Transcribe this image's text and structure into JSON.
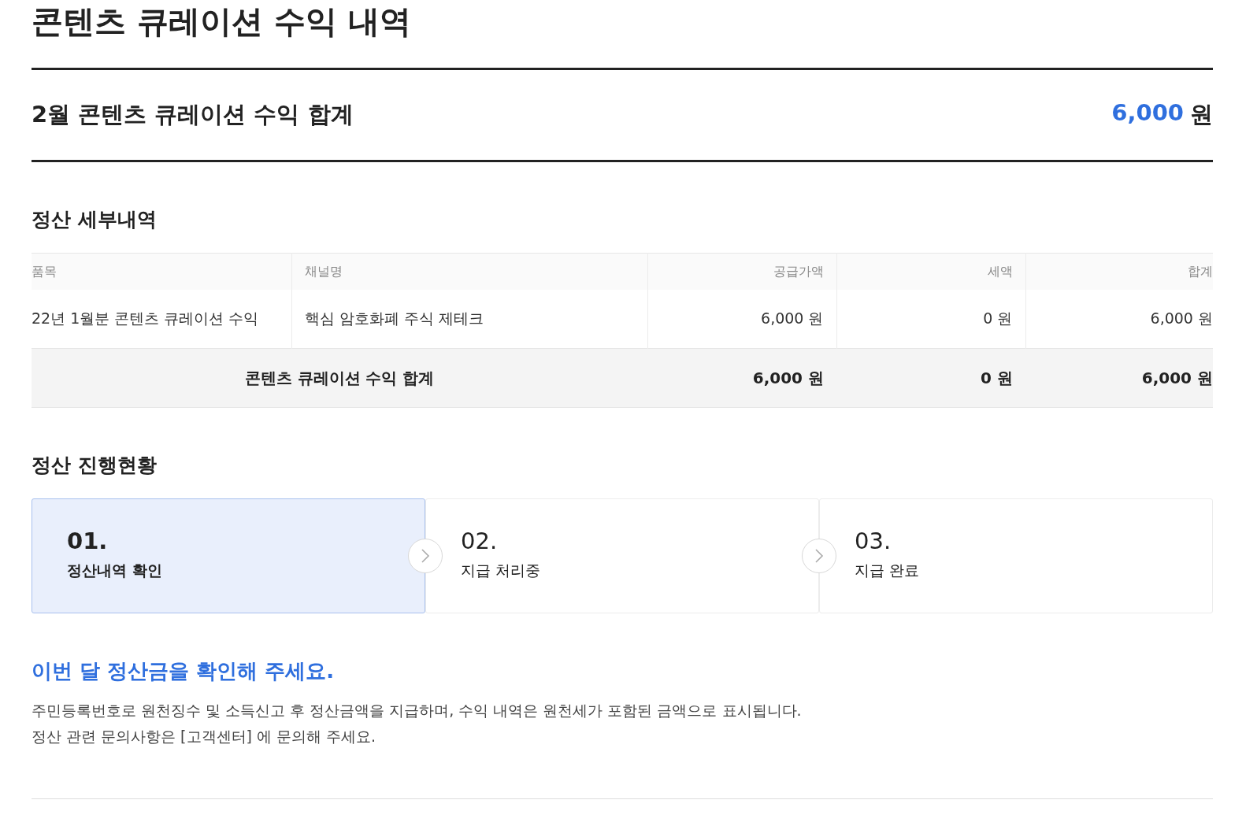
{
  "page_title": "콘텐츠 큐레이션 수익 내역",
  "summary": {
    "label": "2월 콘텐츠 큐레이션 수익 합계",
    "amount": "6,000",
    "unit": "원"
  },
  "details": {
    "heading": "정산 세부내역",
    "table": {
      "columns": [
        "품목",
        "채널명",
        "공급가액",
        "세액",
        "합계"
      ],
      "rows": [
        [
          "22년 1월분 콘텐츠 큐레이션 수익",
          "핵심 암호화폐 주식 제테크",
          "6,000 원",
          "0 원",
          "6,000 원"
        ]
      ],
      "total": {
        "label": "콘텐츠 큐레이션 수익 합계",
        "values": [
          "6,000 원",
          "0 원",
          "6,000 원"
        ]
      }
    }
  },
  "progress": {
    "heading": "정산 진행현황",
    "steps": [
      {
        "number": "01.",
        "label": "정산내역 확인",
        "selected": true
      },
      {
        "number": "02.",
        "label": "지급 처리중",
        "selected": false
      },
      {
        "number": "03.",
        "label": "지급 완료",
        "selected": false
      }
    ]
  },
  "notice": {
    "heading": "이번 달 정산금을 확인해 주세요.",
    "lines": [
      "주민등록번호로 원천징수 및 소득신고 후 정산금액을 지급하며, 수익 내역은 원천세가 포함된 금액으로 표시됩니다.",
      "정산 관련 문의사항은 [고객센터] 에 문의해 주세요."
    ]
  }
}
